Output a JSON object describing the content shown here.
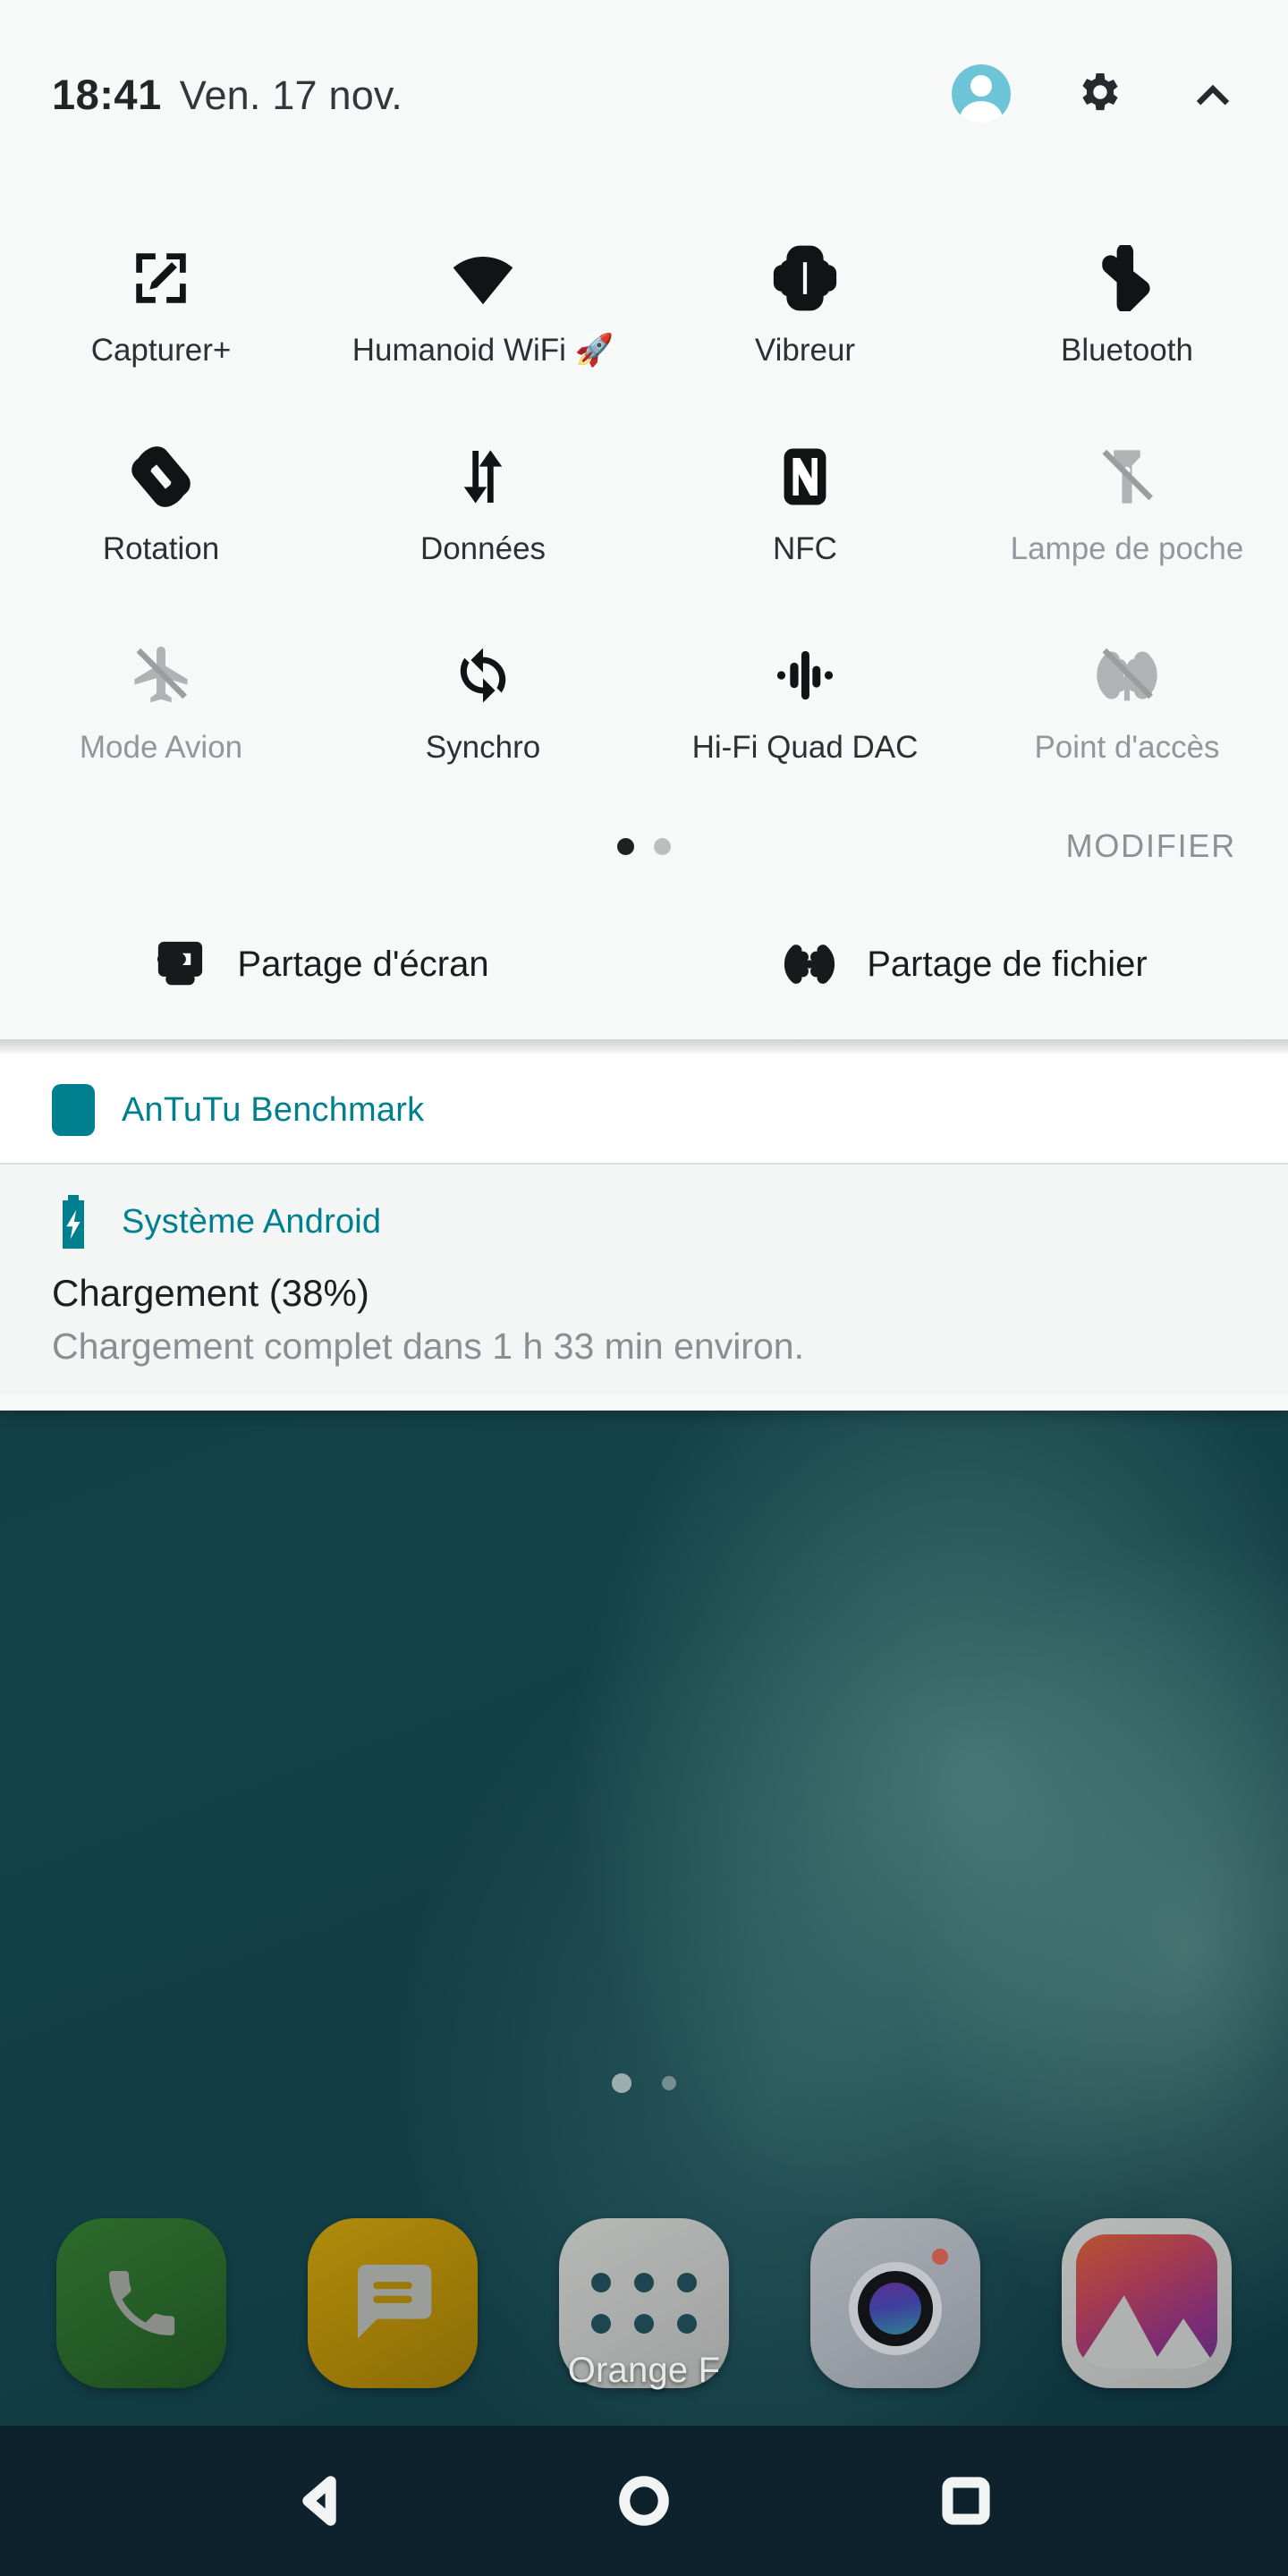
{
  "status": {
    "time": "18:41",
    "date": "Ven. 17 nov.",
    "avatar_icon": "user-avatar-icon",
    "avatar_color": "#6EC4D7",
    "settings_icon": "gear-icon",
    "collapse_icon": "chevron-up-icon"
  },
  "quick_settings": {
    "tiles": [
      {
        "label": "Capturer+",
        "icon": "capture-plus-icon",
        "state": "on"
      },
      {
        "label": "Humanoid WiFi 🚀",
        "icon": "wifi-icon",
        "state": "on"
      },
      {
        "label": "Vibreur",
        "icon": "vibrate-icon",
        "state": "on"
      },
      {
        "label": "Bluetooth",
        "icon": "bluetooth-icon",
        "state": "on"
      },
      {
        "label": "Rotation",
        "icon": "screen-rotation-icon",
        "state": "on"
      },
      {
        "label": "Données",
        "icon": "mobile-data-icon",
        "state": "on"
      },
      {
        "label": "NFC",
        "icon": "nfc-icon",
        "state": "on"
      },
      {
        "label": "Lampe de poche",
        "icon": "flashlight-off-icon",
        "state": "off"
      },
      {
        "label": "Mode Avion",
        "icon": "airplane-off-icon",
        "state": "off"
      },
      {
        "label": "Synchro",
        "icon": "sync-icon",
        "state": "on"
      },
      {
        "label": "Hi-Fi Quad DAC",
        "icon": "waveform-icon",
        "state": "on"
      },
      {
        "label": "Point d'accès",
        "icon": "hotspot-off-icon",
        "state": "off"
      }
    ],
    "pages": {
      "count": 2,
      "active": 1
    },
    "edit_label": "MODIFIER",
    "share": [
      {
        "label": "Partage d'écran",
        "icon": "screen-share-icon"
      },
      {
        "label": "Partage de fichier",
        "icon": "file-share-icon"
      }
    ]
  },
  "notifications": [
    {
      "app": "AnTuTu Benchmark",
      "icon": "antutu-app-icon",
      "accent": "#00808F",
      "title": "",
      "body": ""
    },
    {
      "app": "Système Android",
      "icon": "battery-charging-icon",
      "accent": "#00808F",
      "title": "Chargement (38%)",
      "body": "Chargement complet dans 1 h 33 min environ."
    }
  ],
  "home": {
    "carrier": "Orange F",
    "page_dots": {
      "count": 2,
      "active": 1
    },
    "dock": [
      {
        "label": "Téléphone",
        "icon": "phone-icon"
      },
      {
        "label": "Messages",
        "icon": "message-icon"
      },
      {
        "label": "Applications",
        "icon": "app-drawer-icon"
      },
      {
        "label": "Appareil photo",
        "icon": "camera-icon"
      },
      {
        "label": "Galerie",
        "icon": "gallery-icon"
      }
    ],
    "navbar": [
      {
        "label": "Retour",
        "icon": "back-triangle-icon"
      },
      {
        "label": "Accueil",
        "icon": "home-circle-icon"
      },
      {
        "label": "Récents",
        "icon": "recents-square-icon"
      }
    ]
  }
}
